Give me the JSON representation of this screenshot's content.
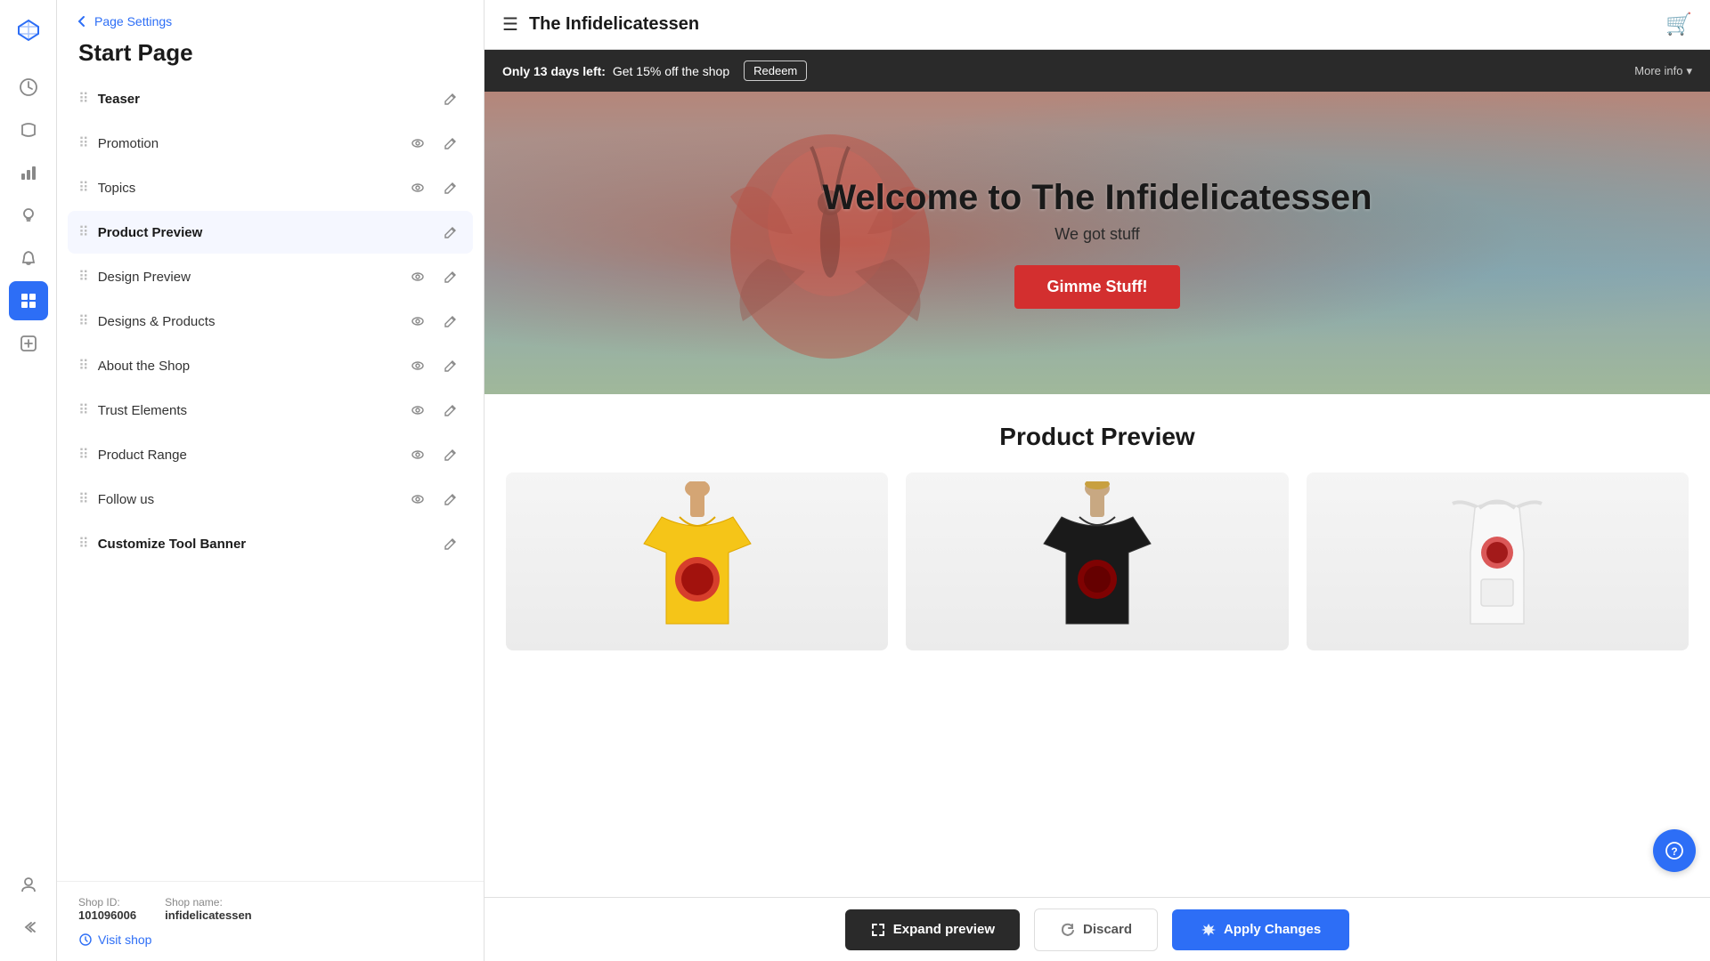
{
  "iconRail": {
    "logo": "♦",
    "items": [
      {
        "name": "dashboard-icon",
        "icon": "◷",
        "active": false
      },
      {
        "name": "products-icon",
        "icon": "👕",
        "active": false
      },
      {
        "name": "analytics-icon",
        "icon": "📊",
        "active": false
      },
      {
        "name": "ideas-icon",
        "icon": "💡",
        "active": false
      },
      {
        "name": "notifications-icon",
        "icon": "🔔",
        "active": false
      },
      {
        "name": "pages-icon",
        "icon": "▦",
        "active": true
      },
      {
        "name": "add-icon",
        "icon": "+",
        "active": false
      }
    ],
    "bottomItems": [
      {
        "name": "profile-icon",
        "icon": "👤"
      },
      {
        "name": "collapse-icon",
        "icon": "«"
      }
    ]
  },
  "sidebar": {
    "backLabel": "Page Settings",
    "title": "Start Page",
    "items": [
      {
        "id": "teaser",
        "label": "Teaser",
        "bold": true,
        "showEye": false,
        "showEdit": true
      },
      {
        "id": "promotion",
        "label": "Promotion",
        "bold": false,
        "showEye": true,
        "showEdit": true
      },
      {
        "id": "topics",
        "label": "Topics",
        "bold": false,
        "showEye": true,
        "showEdit": true
      },
      {
        "id": "product-preview",
        "label": "Product Preview",
        "bold": true,
        "showEye": false,
        "showEdit": true
      },
      {
        "id": "design-preview",
        "label": "Design Preview",
        "bold": false,
        "showEye": true,
        "showEdit": true
      },
      {
        "id": "designs-products",
        "label": "Designs & Products",
        "bold": false,
        "showEye": true,
        "showEdit": true
      },
      {
        "id": "about-shop",
        "label": "About the Shop",
        "bold": false,
        "showEye": true,
        "showEdit": true
      },
      {
        "id": "trust-elements",
        "label": "Trust Elements",
        "bold": false,
        "showEye": true,
        "showEdit": true
      },
      {
        "id": "product-range",
        "label": "Product Range",
        "bold": false,
        "showEye": true,
        "showEdit": true
      },
      {
        "id": "follow-us",
        "label": "Follow us",
        "bold": false,
        "showEye": true,
        "showEdit": true
      },
      {
        "id": "customize-banner",
        "label": "Customize Tool Banner",
        "bold": true,
        "showEye": false,
        "showEdit": true
      }
    ],
    "footer": {
      "shopIdLabel": "Shop ID:",
      "shopIdValue": "101096006",
      "shopNameLabel": "Shop name:",
      "shopNameValue": "infidelicatessen",
      "visitLinkLabel": "Visit shop"
    }
  },
  "preview": {
    "header": {
      "hamburgerLabel": "☰",
      "shopTitle": "The Infidelicatessen",
      "cartLabel": "🛒"
    },
    "promoBanner": {
      "countdownText": "Only 13 days left:",
      "offerText": "Get 15% off the shop",
      "redeemLabel": "Redeem",
      "moreInfoLabel": "More info",
      "chevronLabel": "▾"
    },
    "hero": {
      "title": "Welcome to The Infidelicatessen",
      "subtitle": "We got stuff",
      "buttonLabel": "Gimme Stuff!"
    },
    "productPreview": {
      "sectionTitle": "Product Preview",
      "products": [
        {
          "type": "yellow-tshirt",
          "emoji": "👕",
          "color": "#f5c518"
        },
        {
          "type": "black-tshirt",
          "emoji": "👕",
          "color": "#1a1a1a"
        },
        {
          "type": "white-apron",
          "emoji": "🥗",
          "color": "#f0f0f0"
        }
      ]
    }
  },
  "actionBar": {
    "expandLabel": "Expand preview",
    "expandIcon": "⤢",
    "discardLabel": "Discard",
    "discardIcon": "↩",
    "applyLabel": "Apply Changes",
    "applyIcon": "🚀"
  },
  "support": {
    "icon": "?"
  }
}
